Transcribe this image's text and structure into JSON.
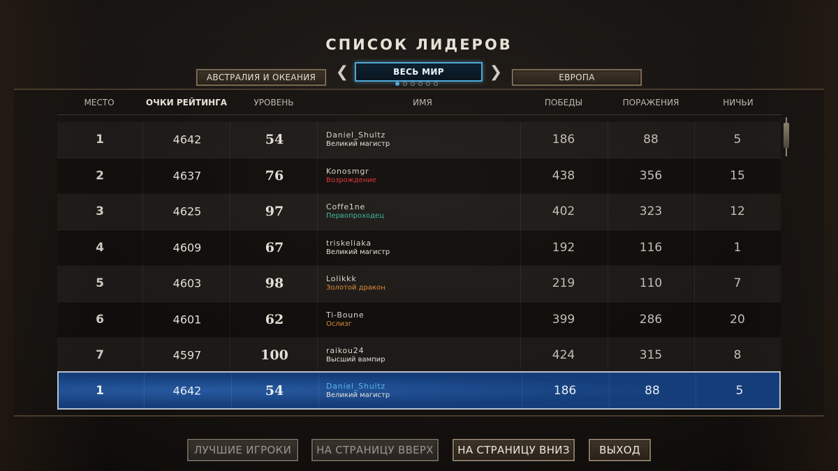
{
  "title": "СПИСОК ЛИДЕРОВ",
  "regions": {
    "left": "АВСТРАЛИЯ И ОКЕАНИЯ",
    "active": "ВЕСЬ МИР",
    "right": "ЕВРОПА",
    "prev_arrow": "❮",
    "next_arrow": "❯",
    "page_dots_total": 6,
    "page_dot_active": 1
  },
  "columns": {
    "rank": "МЕСТО",
    "rating": "ОЧКИ РЕЙТИНГА",
    "level": "УРОВЕНЬ",
    "name": "ИМЯ",
    "wins": "ПОБЕДЫ",
    "losses": "ПОРАЖЕНИЯ",
    "draws": "НИЧЬИ"
  },
  "rows": [
    {
      "rank": "1",
      "rating": "4642",
      "level": "54",
      "name": "Daniel_Shultz",
      "title": "Великий магистр",
      "title_color": "#e6e2da",
      "wins": "186",
      "losses": "88",
      "draws": "5"
    },
    {
      "rank": "2",
      "rating": "4637",
      "level": "76",
      "name": "Konosmgr",
      "title": "Возрождение",
      "title_color": "#e0363a",
      "wins": "438",
      "losses": "356",
      "draws": "15"
    },
    {
      "rank": "3",
      "rating": "4625",
      "level": "97",
      "name": "Coffe1ne",
      "title": "Первопроходец",
      "title_color": "#3fb8a4",
      "wins": "402",
      "losses": "323",
      "draws": "12"
    },
    {
      "rank": "4",
      "rating": "4609",
      "level": "67",
      "name": "triskeliaka",
      "title": "Великий магистр",
      "title_color": "#e6e2da",
      "wins": "192",
      "losses": "116",
      "draws": "1"
    },
    {
      "rank": "5",
      "rating": "4603",
      "level": "98",
      "name": "Lolikkk",
      "title": "Золотой дракон",
      "title_color": "#e08a3a",
      "wins": "219",
      "losses": "110",
      "draws": "7"
    },
    {
      "rank": "6",
      "rating": "4601",
      "level": "62",
      "name": "Ti-Boune",
      "title": "Ослизг",
      "title_color": "#e08a3a",
      "wins": "399",
      "losses": "286",
      "draws": "20"
    },
    {
      "rank": "7",
      "rating": "4597",
      "level": "100",
      "name": "raikou24",
      "title": "Высший вампир",
      "title_color": "#e6e2da",
      "wins": "424",
      "losses": "315",
      "draws": "8"
    }
  ],
  "own_row": {
    "rank": "1",
    "rating": "4642",
    "level": "54",
    "name": "Daniel_Shultz",
    "title": "Великий магистр",
    "wins": "186",
    "losses": "88",
    "draws": "5"
  },
  "buttons": {
    "top_players": "ЛУЧШИЕ ИГРОКИ",
    "page_up": "НА СТРАНИЦУ ВВЕРХ",
    "page_down": "НА СТРАНИЦУ ВНИЗ",
    "exit": "ВЫХОД"
  },
  "colors": {
    "active_tab_border": "#4fa9d6",
    "own_row_bg": "#1d56a0",
    "own_name": "#58b6e8"
  }
}
